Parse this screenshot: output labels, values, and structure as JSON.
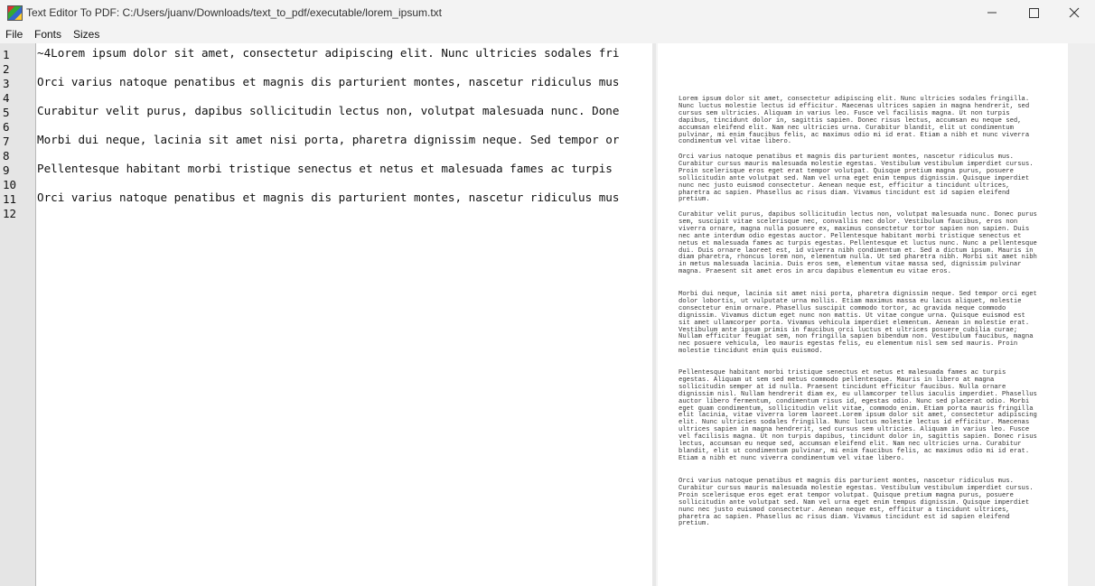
{
  "window": {
    "title": "Text Editor To PDF: C:/Users/juanv/Downloads/text_to_pdf/executable/lorem_ipsum.txt"
  },
  "menu": [
    "File",
    "Fonts",
    "Sizes"
  ],
  "line_numbers": [
    "1",
    "2",
    "3",
    "4",
    "5",
    "6",
    "7",
    "8",
    "9",
    "10",
    "11",
    "12"
  ],
  "editor_lines": [
    "~4Lorem ipsum dolor sit amet, consectetur adipiscing elit. Nunc ultricies sodales fri",
    "",
    "Orci varius natoque penatibus et magnis dis parturient montes, nascetur ridiculus mus",
    "",
    "Curabitur velit purus, dapibus sollicitudin lectus non, volutpat malesuada nunc. Done",
    "",
    "Morbi dui neque, lacinia sit amet nisi porta, pharetra dignissim neque. Sed tempor or",
    "",
    "Pellentesque habitant morbi tristique senectus et netus et malesuada fames ac turpis",
    "",
    "Orci varius natoque penatibus et magnis dis parturient montes, nascetur ridiculus mus",
    ""
  ],
  "preview_paragraphs": [
    "Lorem ipsum dolor sit amet, consectetur adipiscing elit. Nunc ultricies sodales fringilla. Nunc luctus molestie lectus id efficitur. Maecenas ultrices sapien in magna hendrerit, sed cursus sem ultricies. Aliquam in varius leo. Fusce vel facilisis magna. Ut non turpis dapibus, tincidunt dolor in, sagittis sapien. Donec risus lectus, accumsan eu neque sed, accumsan eleifend elit. Nam nec ultricies urna. Curabitur blandit, elit ut condimentum pulvinar, mi enim faucibus felis, ac maximus odio mi id erat. Etiam a nibh et nunc viverra condimentum vel vitae libero.",
    "Orci varius natoque penatibus et magnis dis parturient montes, nascetur ridiculus mus. Curabitur cursus mauris malesuada molestie egestas. Vestibulum vestibulum imperdiet cursus. Proin scelerisque eros eget erat tempor volutpat. Quisque pretium magna purus, posuere sollicitudin ante volutpat sed. Nam vel urna eget enim tempus dignissim. Quisque imperdiet nunc nec justo euismod consectetur. Aenean neque est, efficitur a tincidunt ultrices, pharetra ac sapien. Phasellus ac risus diam. Vivamus tincidunt est id sapien eleifend pretium.",
    "Curabitur velit purus, dapibus sollicitudin lectus non, volutpat malesuada nunc. Donec purus sem, suscipit vitae scelerisque nec, convallis nec dolor. Vestibulum faucibus, eros non viverra ornare, magna nulla posuere ex, maximus consectetur tortor sapien non sapien. Duis nec ante interdum odio egestas auctor. Pellentesque habitant morbi tristique senectus et netus et malesuada fames ac turpis egestas. Pellentesque et luctus nunc. Nunc a pellentesque dui. Duis ornare laoreet est, id viverra nibh condimentum et. Sed a dictum ipsum. Mauris in diam pharetra, rhoncus lorem non, elementum nulla. Ut sed pharetra nibh. Morbi sit amet nibh in metus malesuada lacinia. Duis eros sem, elementum vitae massa sed, dignissim pulvinar magna. Praesent sit amet eros in arcu dapibus elementum eu vitae eros.",
    "Morbi dui neque, lacinia sit amet nisi porta, pharetra dignissim neque. Sed tempor orci eget dolor lobortis, ut vulputate urna mollis. Etiam maximus massa eu lacus aliquet, molestie consectetur enim ornare. Phasellus suscipit commodo tortor, ac gravida neque commodo dignissim. Vivamus dictum eget nunc non mattis. Ut vitae congue urna. Quisque euismod est sit amet ullamcorper porta. Vivamus vehicula imperdiet elementum. Aenean in molestie erat. Vestibulum ante ipsum primis in faucibus orci luctus et ultrices posuere cubilia curae; Nullam efficitur feugiat sem, non fringilla sapien bibendum non. Vestibulum faucibus, magna nec posuere vehicula, leo mauris egestas felis, eu elementum nisl sem sed mauris. Proin molestie tincidunt enim quis euismod.",
    "Pellentesque habitant morbi tristique senectus et netus et malesuada fames ac turpis egestas. Aliquam ut sem sed metus commodo pellentesque. Mauris in libero at magna sollicitudin semper at id nulla. Praesent tincidunt efficitur faucibus. Nulla ornare dignissim nisl. Nullam hendrerit diam ex, eu ullamcorper tellus iaculis imperdiet. Phasellus auctor libero fermentum, condimentum risus id, egestas odio. Nunc sed placerat odio. Morbi eget quam condimentum, sollicitudin velit vitae, commodo enim. Etiam porta mauris fringilla elit lacinia, vitae viverra lorem laoreet.Lorem ipsum dolor sit amet, consectetur adipiscing elit. Nunc ultricies sodales fringilla. Nunc luctus molestie lectus id efficitur. Maecenas ultrices sapien in magna hendrerit, sed cursus sem ultricies. Aliquam in varius leo. Fusce vel facilisis magna. Ut non turpis dapibus, tincidunt dolor in, sagittis sapien. Donec risus lectus, accumsan eu neque sed, accumsan eleifend elit. Nam nec ultricies urna. Curabitur blandit, elit ut condimentum pulvinar, mi enim faucibus felis, ac maximus odio mi id erat. Etiam a nibh et nunc viverra condimentum vel vitae libero.",
    "Orci varius natoque penatibus et magnis dis parturient montes, nascetur ridiculus mus. Curabitur cursus mauris malesuada molestie egestas. Vestibulum vestibulum imperdiet cursus. Proin scelerisque eros eget erat tempor volutpat. Quisque pretium magna purus, posuere sollicitudin ante volutpat sed. Nam vel urna eget enim tempus dignissim. Quisque imperdiet nunc nec justo euismod consectetur. Aenean neque est, efficitur a tincidunt ultrices, pharetra ac sapien. Phasellus ac risus diam. Vivamus tincidunt est id sapien eleifend pretium."
  ]
}
